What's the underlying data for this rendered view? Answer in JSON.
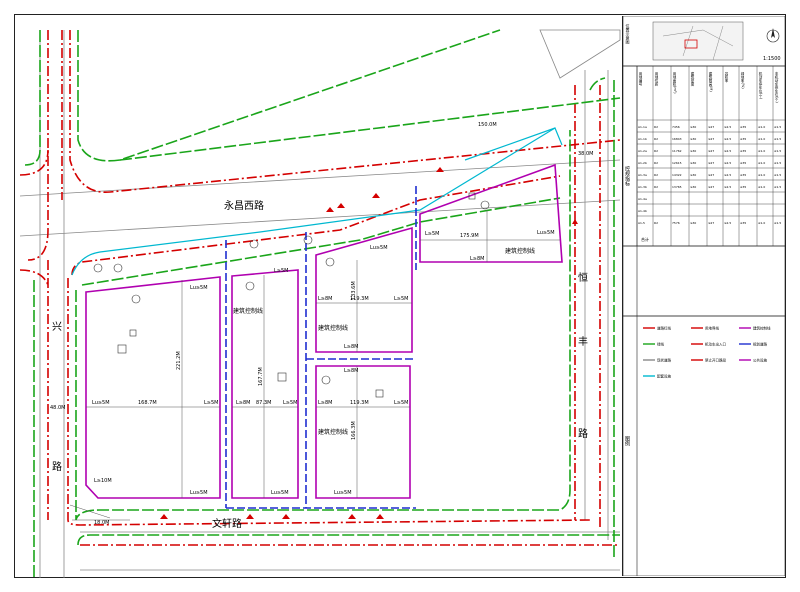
{
  "roads": {
    "yongchang": "永昌西路",
    "xing_left_top": "兴",
    "xing_left_bottom": "路",
    "wenxuan": "文轩路",
    "heng_right_top": "恒",
    "heng_right_mid": "丰",
    "heng_right_bottom": "路"
  },
  "parcel_labels": {
    "control_line": "建筑控制线"
  },
  "dimensions": {
    "lu5m": "Lu≥5M",
    "l5m": "L≥5M",
    "l8m": "L≥8M",
    "l10m": "L≥10M",
    "d168_7": "168.7M",
    "d87_3": "87.3M",
    "d119_3": "119.3M",
    "d175_9": "175.9M",
    "d221_2": "221.2M",
    "d167_7": "167.7M",
    "d133_6": "133.6M",
    "d166_3": "166.3M",
    "d18_0": "18.0M",
    "d48_0": "48.0M",
    "d38_0": "38.0M",
    "d150_0": "150.0M"
  },
  "panel": {
    "location_title": "位置示意图",
    "scale": "1:1500",
    "headers": [
      "用地编号",
      "用地性质",
      "用地面积(m²)",
      "建筑密度",
      "建筑限高(M)",
      "容积率",
      "绿地率(%)",
      "机动车停车位(个)",
      "非机动车停车位(个)"
    ],
    "rows": [
      [
        "A1-1a",
        "R2",
        "7456",
        "≤30",
        "≤27",
        "≤2.5",
        "≥35",
        "≥1.0",
        "≥1.5"
      ],
      [
        "A1-1b",
        "R2",
        "16843",
        "≤30",
        "≤27",
        "≤2.5",
        "≥35",
        "≥1.0",
        "≥1.5"
      ],
      [
        "A1-2a",
        "R2",
        "11762",
        "≤30",
        "≤27",
        "≤2.5",
        "≥35",
        "≥1.0",
        "≥1.5"
      ],
      [
        "A1-2b",
        "R2",
        "12615",
        "≤30",
        "≤27",
        "≤2.5",
        "≥35",
        "≥1.0",
        "≥1.5"
      ],
      [
        "A1-3a",
        "R2",
        "14322",
        "≤30",
        "≤27",
        "≤2.5",
        "≥35",
        "≥1.0",
        "≥1.5"
      ],
      [
        "A1-3b",
        "R2",
        "13765",
        "≤30",
        "≤27",
        "≤2.5",
        "≥35",
        "≥1.0",
        "≥1.5"
      ],
      [
        "A1-4a",
        "",
        "",
        "",
        "",
        "",
        "",
        "",
        ""
      ],
      [
        "A1-4b",
        "",
        "",
        "",
        "",
        "",
        "",
        "",
        ""
      ],
      [
        "A1-5",
        "R2",
        "7576",
        "≤30",
        "≤27",
        "≤2.5",
        "≥35",
        "≥1.0",
        "≥1.5"
      ]
    ],
    "notes_label": "控规指标",
    "legend_label": "图例",
    "legend_items": [
      "道路红线",
      "用地界线",
      "建筑控制线",
      "绿线",
      "机动车出入口",
      "规划道路",
      "现状道路",
      "禁止开口路段",
      "公共设施",
      "配套设施"
    ],
    "total_label": "合计"
  },
  "colors": {
    "road_red": "#d40000",
    "green": "#1aa51a",
    "magenta": "#b000b0",
    "blue": "#1f2fd0",
    "cyan": "#00b8d0",
    "grey": "#888888"
  }
}
